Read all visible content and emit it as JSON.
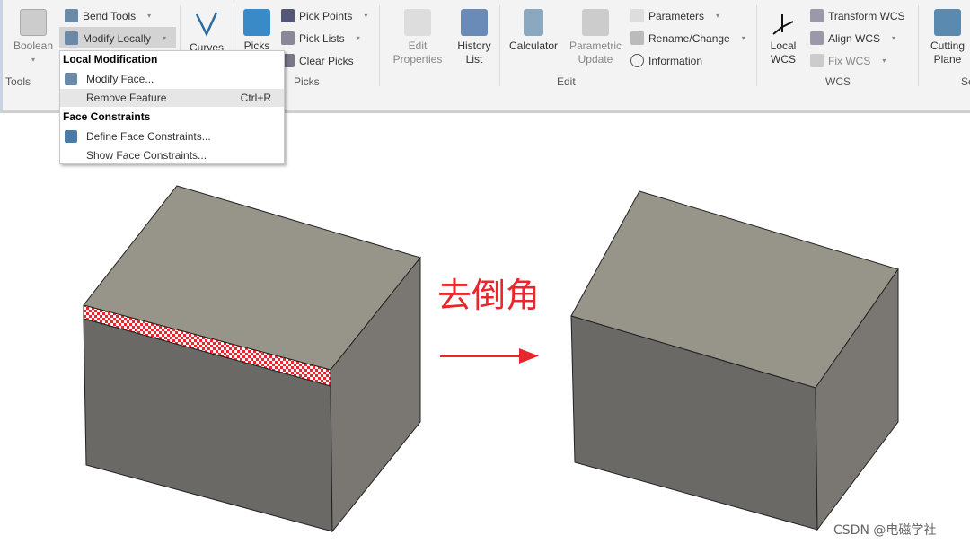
{
  "ribbon": {
    "boolean": "Boolean",
    "tools_group": "Tools",
    "bend_tools": "Bend Tools",
    "modify_locally": "Modify Locally",
    "curves": "Curves",
    "picks": "Picks",
    "pick_points": "Pick Points",
    "pick_lists": "Pick Lists",
    "clear_picks": "Clear Picks",
    "picks_group": "Picks",
    "edit_properties": [
      "Edit",
      "Properties"
    ],
    "history_list": [
      "History",
      "List"
    ],
    "calculator": "Calculator",
    "parametric_update": [
      "Parametric",
      "Update"
    ],
    "parameters": "Parameters",
    "rename_change": "Rename/Change",
    "information": "Information",
    "edit_group": "Edit",
    "local_wcs": [
      "Local",
      "WCS"
    ],
    "transform_wcs": "Transform WCS",
    "align_wcs": "Align WCS",
    "fix_wcs": "Fix WCS",
    "wcs_group": "WCS",
    "cutting_plane": [
      "Cutting",
      "Plane"
    ],
    "se_group": "Se"
  },
  "menu": {
    "local_modification": "Local Modification",
    "modify_face": "Modify Face...",
    "remove_feature": "Remove Feature",
    "remove_feature_shortcut": "Ctrl+R",
    "face_constraints": "Face Constraints",
    "define_face_constraints": "Define Face Constraints...",
    "show_face_constraints": "Show Face Constraints..."
  },
  "canvas": {
    "annotation": "去倒角",
    "watermark": "CSDN @电磁学社",
    "arrow_color": "#e8262b",
    "chamfer_highlight": "#e8262b"
  }
}
